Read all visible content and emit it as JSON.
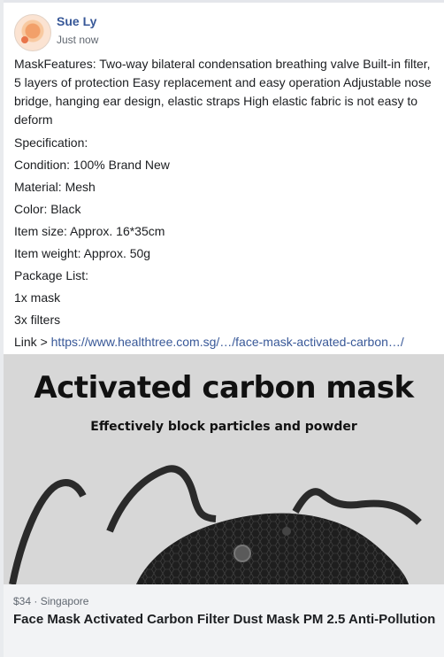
{
  "post": {
    "author": "Sue Ly",
    "time": "Just now",
    "description": "MaskFeatures: Two-way bilateral condensation breathing valve Built-in filter, 5 layers of protection Easy replacement and easy operation Adjustable nose bridge, hanging ear design, elastic straps High elastic fabric is not easy to deform",
    "lines": [
      "Specification:",
      "Condition: 100% Brand New",
      "Material: Mesh",
      "Color: Black",
      "Item size: Approx. 16*35cm",
      "Item weight: Approx. 50g",
      "Package List:",
      "1x mask",
      "3x filters"
    ],
    "link_prefix": "Link > ",
    "link_text": "https://www.healthtree.com.sg/…/face-mask-activated-carbon…/"
  },
  "image": {
    "headline": "Activated carbon mask",
    "subline": "Effectively block particles and powder"
  },
  "listing": {
    "price": "$34",
    "separator": " · ",
    "location": "Singapore",
    "title": "Face Mask Activated Carbon Filter Dust Mask PM 2.5 Anti-Pollution"
  },
  "colors": {
    "link": "#385898",
    "text": "#1c1e21",
    "muted": "#606770",
    "footer_bg": "#f2f3f5"
  }
}
